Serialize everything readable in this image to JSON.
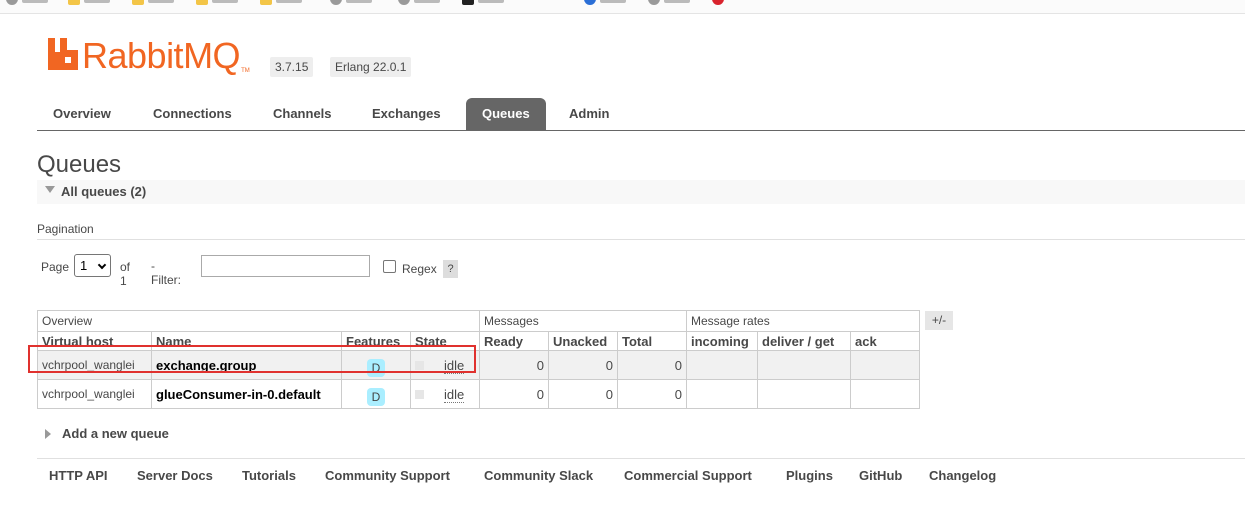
{
  "header": {
    "logo_text": "RabbitMQ",
    "logo_tm": "TM",
    "version": "3.7.15",
    "erlang": "Erlang 22.0.1"
  },
  "tabs": [
    {
      "label": "Overview",
      "active": false
    },
    {
      "label": "Connections",
      "active": false
    },
    {
      "label": "Channels",
      "active": false
    },
    {
      "label": "Exchanges",
      "active": false
    },
    {
      "label": "Queues",
      "active": true
    },
    {
      "label": "Admin",
      "active": false
    }
  ],
  "page": {
    "title": "Queues",
    "section_label": "All queues (2)"
  },
  "pagination": {
    "heading": "Pagination",
    "page_label": "Page",
    "page_value": "1",
    "of_label": "of 1",
    "filter_label": "- Filter:",
    "filter_value": "",
    "regex_label": "Regex",
    "help_label": "?"
  },
  "table": {
    "groups": [
      "Overview",
      "Messages",
      "Message rates"
    ],
    "columns": [
      "Virtual host",
      "Name",
      "Features",
      "State",
      "Ready",
      "Unacked",
      "Total",
      "incoming",
      "deliver / get",
      "ack"
    ],
    "toggle_label": "+/-",
    "rows": [
      {
        "vhost": "vchrpool_wanglei",
        "name": "exchange.group",
        "feature": "D",
        "state": "idle",
        "ready": "0",
        "unacked": "0",
        "total": "0",
        "incoming": "",
        "deliver": "",
        "ack": ""
      },
      {
        "vhost": "vchrpool_wanglei",
        "name": "glueConsumer-in-0.default",
        "feature": "D",
        "state": "idle",
        "ready": "0",
        "unacked": "0",
        "total": "0",
        "incoming": "",
        "deliver": "",
        "ack": ""
      }
    ]
  },
  "add_queue_label": "Add a new queue",
  "footer": [
    "HTTP API",
    "Server Docs",
    "Tutorials",
    "Community Support",
    "Community Slack",
    "Commercial Support",
    "Plugins",
    "GitHub",
    "Changelog"
  ],
  "colors": {
    "brand": "#f16622",
    "tab_active": "#666666",
    "feature_badge": "#aaeeff",
    "highlight": "#e0312e"
  }
}
